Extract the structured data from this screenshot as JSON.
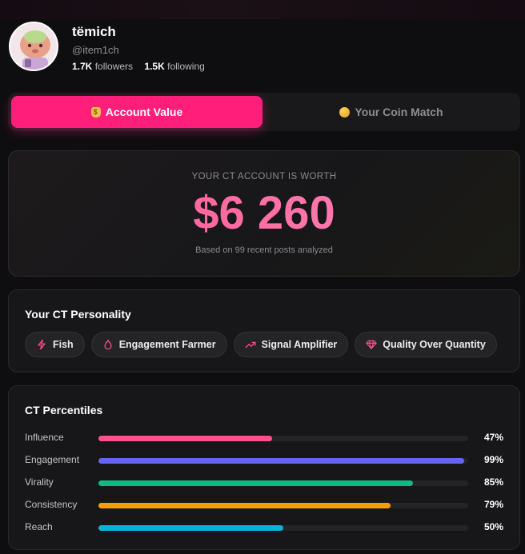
{
  "profile": {
    "name": "tëmich",
    "handle": "@item1ch",
    "followers_count": "1.7K",
    "followers_label": "followers",
    "following_count": "1.5K",
    "following_label": "following"
  },
  "tabs": [
    {
      "label": "Account Value",
      "icon": "money-bag-icon",
      "active": true
    },
    {
      "label": "Your Coin Match",
      "icon": "coin-icon",
      "active": false
    }
  ],
  "account_value": {
    "label": "YOUR CT ACCOUNT IS WORTH",
    "value": "$6 260",
    "subtitle": "Based on 99 recent posts analyzed"
  },
  "personality": {
    "title": "Your CT Personality",
    "chips": [
      {
        "label": "Fish",
        "icon": "lightning-icon"
      },
      {
        "label": "Engagement Farmer",
        "icon": "flame-icon"
      },
      {
        "label": "Signal Amplifier",
        "icon": "trending-up-icon"
      },
      {
        "label": "Quality Over Quantity",
        "icon": "diamond-icon"
      }
    ]
  },
  "percentiles": {
    "title": "CT Percentiles",
    "rows": [
      {
        "label": "Influence",
        "percent": 47,
        "value_text": "47%",
        "color": "#ff4f8c"
      },
      {
        "label": "Engagement",
        "percent": 99,
        "value_text": "99%",
        "color": "#6366f1"
      },
      {
        "label": "Virality",
        "percent": 85,
        "value_text": "85%",
        "color": "#10b981"
      },
      {
        "label": "Consistency",
        "percent": 79,
        "value_text": "79%",
        "color": "#f59e0b"
      },
      {
        "label": "Reach",
        "percent": 50,
        "value_text": "50%",
        "color": "#06b6d4"
      }
    ]
  },
  "colors": {
    "accent": "#ff1f7a",
    "background": "#0e0e10",
    "card": "#171719"
  }
}
